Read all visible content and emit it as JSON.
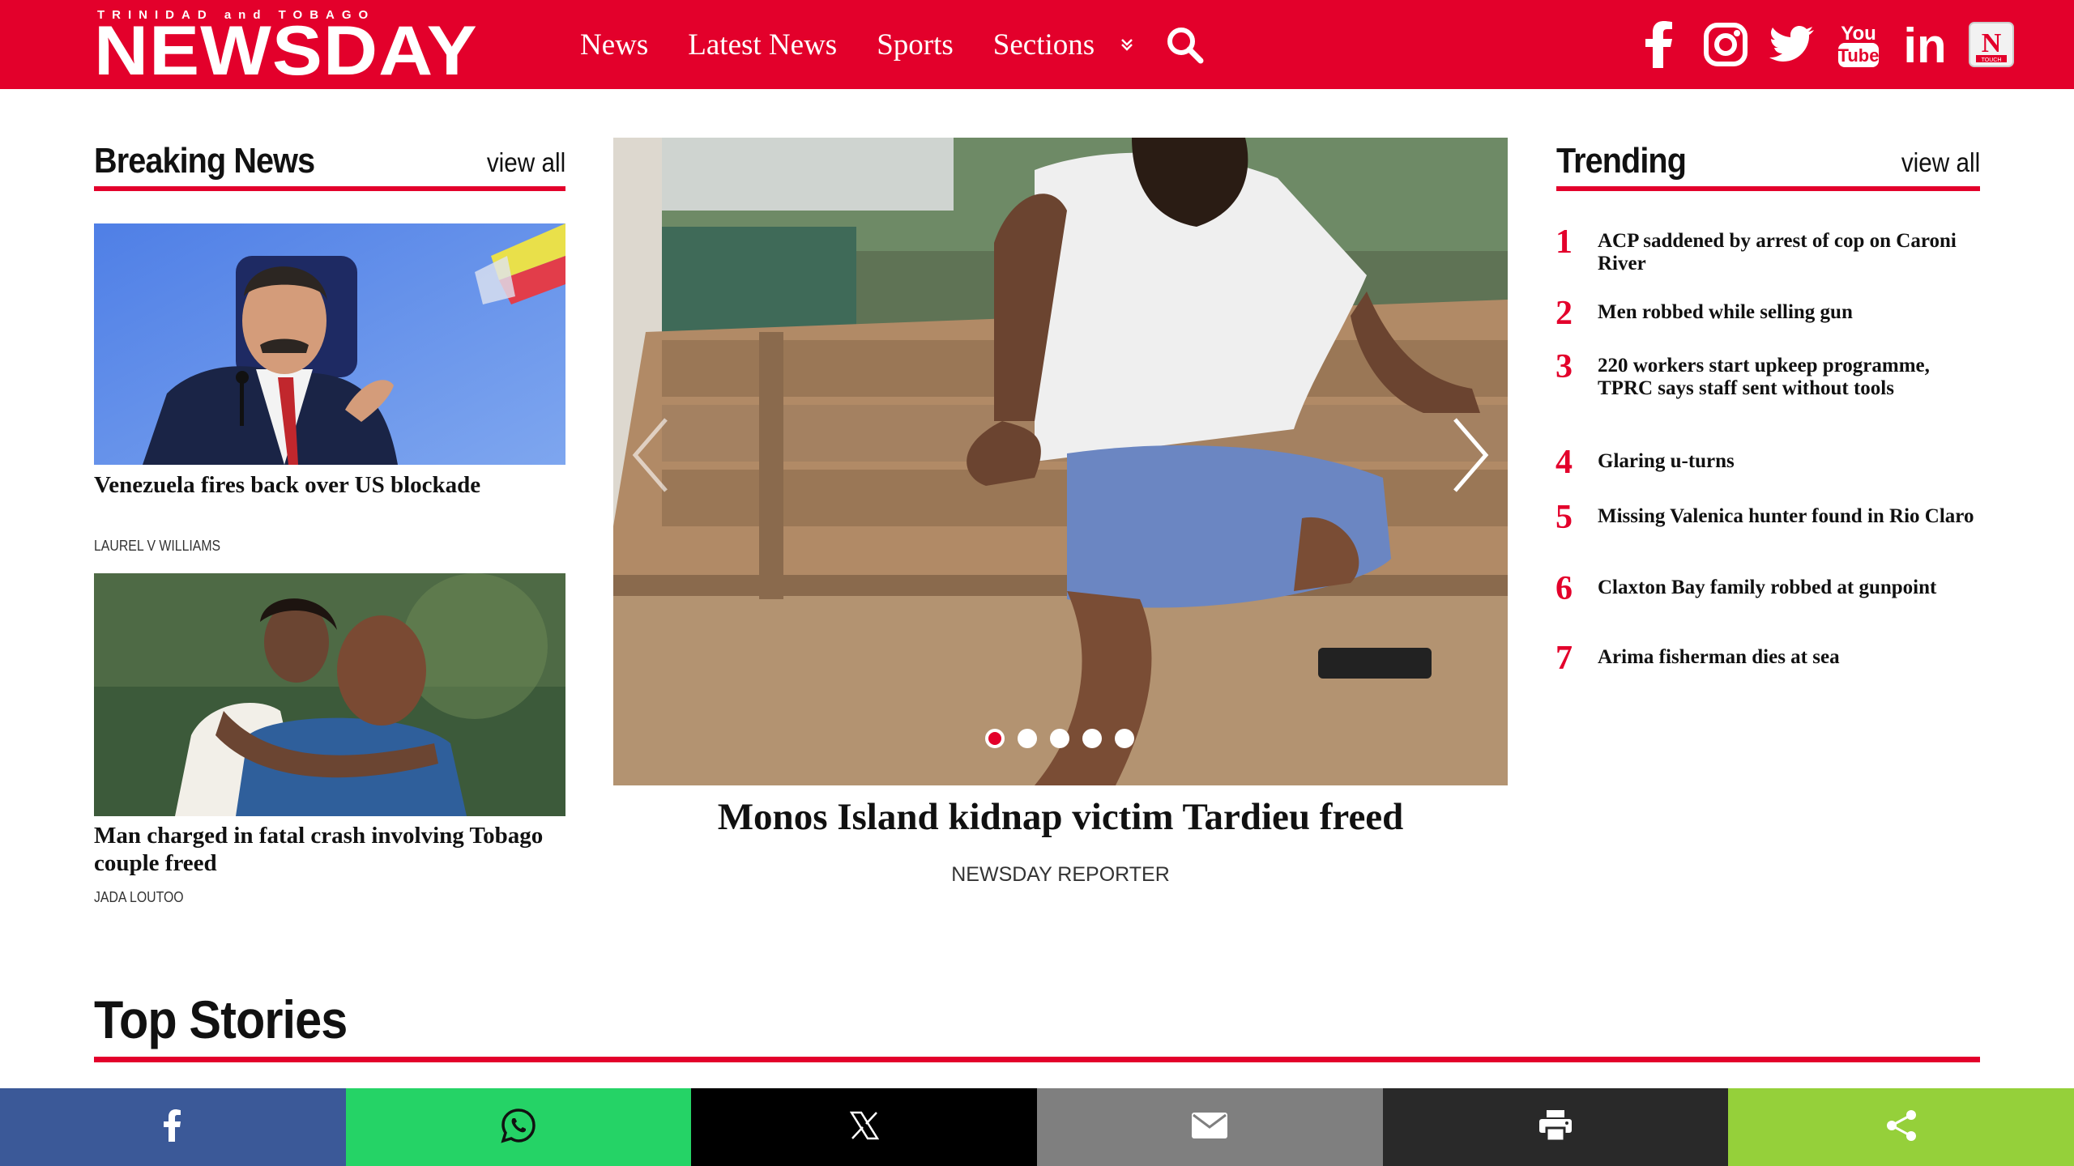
{
  "header": {
    "logo_tagline": "TRINIDAD and TOBAGO",
    "logo_brand": "NEWSDAY",
    "nav": [
      {
        "label": "News"
      },
      {
        "label": "Latest News"
      },
      {
        "label": "Sports"
      },
      {
        "label": "Sections"
      }
    ],
    "social_icons": [
      "facebook-icon",
      "instagram-icon",
      "twitter-icon",
      "youtube-icon",
      "linkedin-icon",
      "newsday-app-icon"
    ],
    "social_text": {
      "youtube_top": "You",
      "youtube_bottom": "Tube",
      "linkedin": "in",
      "app_letter": "N",
      "app_caption": "TOUCH"
    },
    "accent_color": "#e3002b"
  },
  "breaking": {
    "title": "Breaking News",
    "view_all": "view all",
    "items": [
      {
        "headline": "Venezuela fires back over US blockade",
        "author": "LAUREL V WILLIAMS"
      },
      {
        "headline": "Man charged in fatal crash involving Tobago couple freed",
        "author": "JADA LOUTOO"
      }
    ]
  },
  "feature": {
    "headline": "Monos Island kidnap victim Tardieu freed",
    "author": "NEWSDAY REPORTER",
    "slides": 5,
    "active_slide": 1
  },
  "trending": {
    "title": "Trending",
    "view_all": "view all",
    "items": [
      {
        "num": "1",
        "headline": "ACP saddened by arrest of cop on Caroni River"
      },
      {
        "num": "2",
        "headline": "Men robbed while selling gun"
      },
      {
        "num": "3",
        "headline": "220 workers start upkeep programme, TPRC says staff sent without tools"
      },
      {
        "num": "4",
        "headline": "Glaring u-turns"
      },
      {
        "num": "5",
        "headline": "Missing Valenica hunter found in Rio Claro"
      },
      {
        "num": "6",
        "headline": "Claxton Bay family robbed at gunpoint"
      },
      {
        "num": "7",
        "headline": "Arima fisherman dies at sea"
      }
    ]
  },
  "top_stories": {
    "title": "Top Stories"
  },
  "share_bar": [
    {
      "icon": "facebook-share-icon",
      "color": "#3b5998"
    },
    {
      "icon": "whatsapp-share-icon",
      "color": "#25d366"
    },
    {
      "icon": "x-share-icon",
      "color": "#000000"
    },
    {
      "icon": "email-share-icon",
      "color": "#7f7f7f"
    },
    {
      "icon": "print-share-icon",
      "color": "#292929"
    },
    {
      "icon": "share-icon",
      "color": "#95d03a"
    }
  ]
}
